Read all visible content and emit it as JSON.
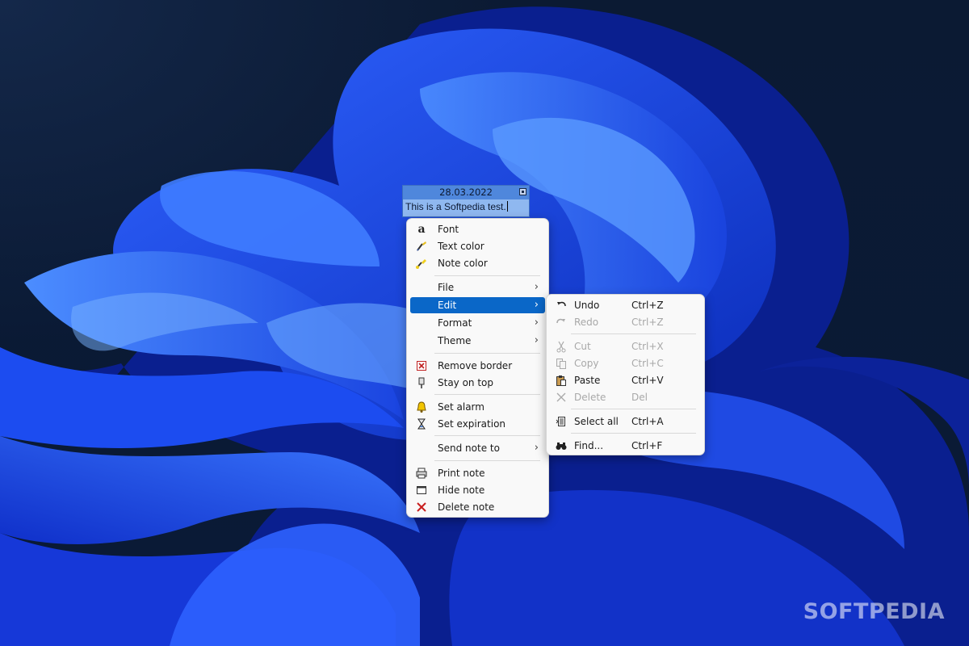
{
  "note": {
    "date": "28.03.2022",
    "text": "This is a Softpedia test."
  },
  "main_menu": {
    "items": [
      {
        "label": "Font",
        "icon": "font-a-icon"
      },
      {
        "label": "Text color",
        "icon": "brush-icon"
      },
      {
        "label": "Note color",
        "icon": "paint-brush-icon"
      },
      {
        "label": "File",
        "submenu": true
      },
      {
        "label": "Edit",
        "submenu": true,
        "highlighted": true
      },
      {
        "label": "Format",
        "submenu": true
      },
      {
        "label": "Theme",
        "submenu": true
      },
      {
        "label": "Remove border",
        "icon": "remove-border-icon"
      },
      {
        "label": "Stay on top",
        "icon": "pin-icon"
      },
      {
        "label": "Set alarm",
        "icon": "bell-icon"
      },
      {
        "label": "Set expiration",
        "icon": "hourglass-icon"
      },
      {
        "label": "Send note to",
        "submenu": true
      },
      {
        "label": "Print note",
        "icon": "printer-icon"
      },
      {
        "label": "Hide note",
        "icon": "window-icon"
      },
      {
        "label": "Delete note",
        "icon": "red-x-icon"
      }
    ]
  },
  "edit_menu": {
    "items": [
      {
        "label": "Undo",
        "shortcut": "Ctrl+Z",
        "enabled": true,
        "icon": "undo-icon"
      },
      {
        "label": "Redo",
        "shortcut": "Ctrl+Z",
        "enabled": false,
        "icon": "redo-icon"
      },
      {
        "label": "Cut",
        "shortcut": "Ctrl+X",
        "enabled": false,
        "icon": "scissors-icon"
      },
      {
        "label": "Copy",
        "shortcut": "Ctrl+C",
        "enabled": false,
        "icon": "copy-icon"
      },
      {
        "label": "Paste",
        "shortcut": "Ctrl+V",
        "enabled": true,
        "icon": "clipboard-icon"
      },
      {
        "label": "Delete",
        "shortcut": "Del",
        "enabled": false,
        "icon": "x-icon"
      },
      {
        "label": "Select all",
        "shortcut": "Ctrl+A",
        "enabled": true,
        "icon": "select-all-icon"
      },
      {
        "label": "Find...",
        "shortcut": "Ctrl+F",
        "enabled": true,
        "icon": "binoculars-icon"
      }
    ]
  },
  "colors": {
    "highlight": "#0a67c8",
    "note_header": "#4f87dc",
    "note_body": "#8fb8f0",
    "desktop": "#0b1a33"
  },
  "watermark": "SOFTPEDIA"
}
